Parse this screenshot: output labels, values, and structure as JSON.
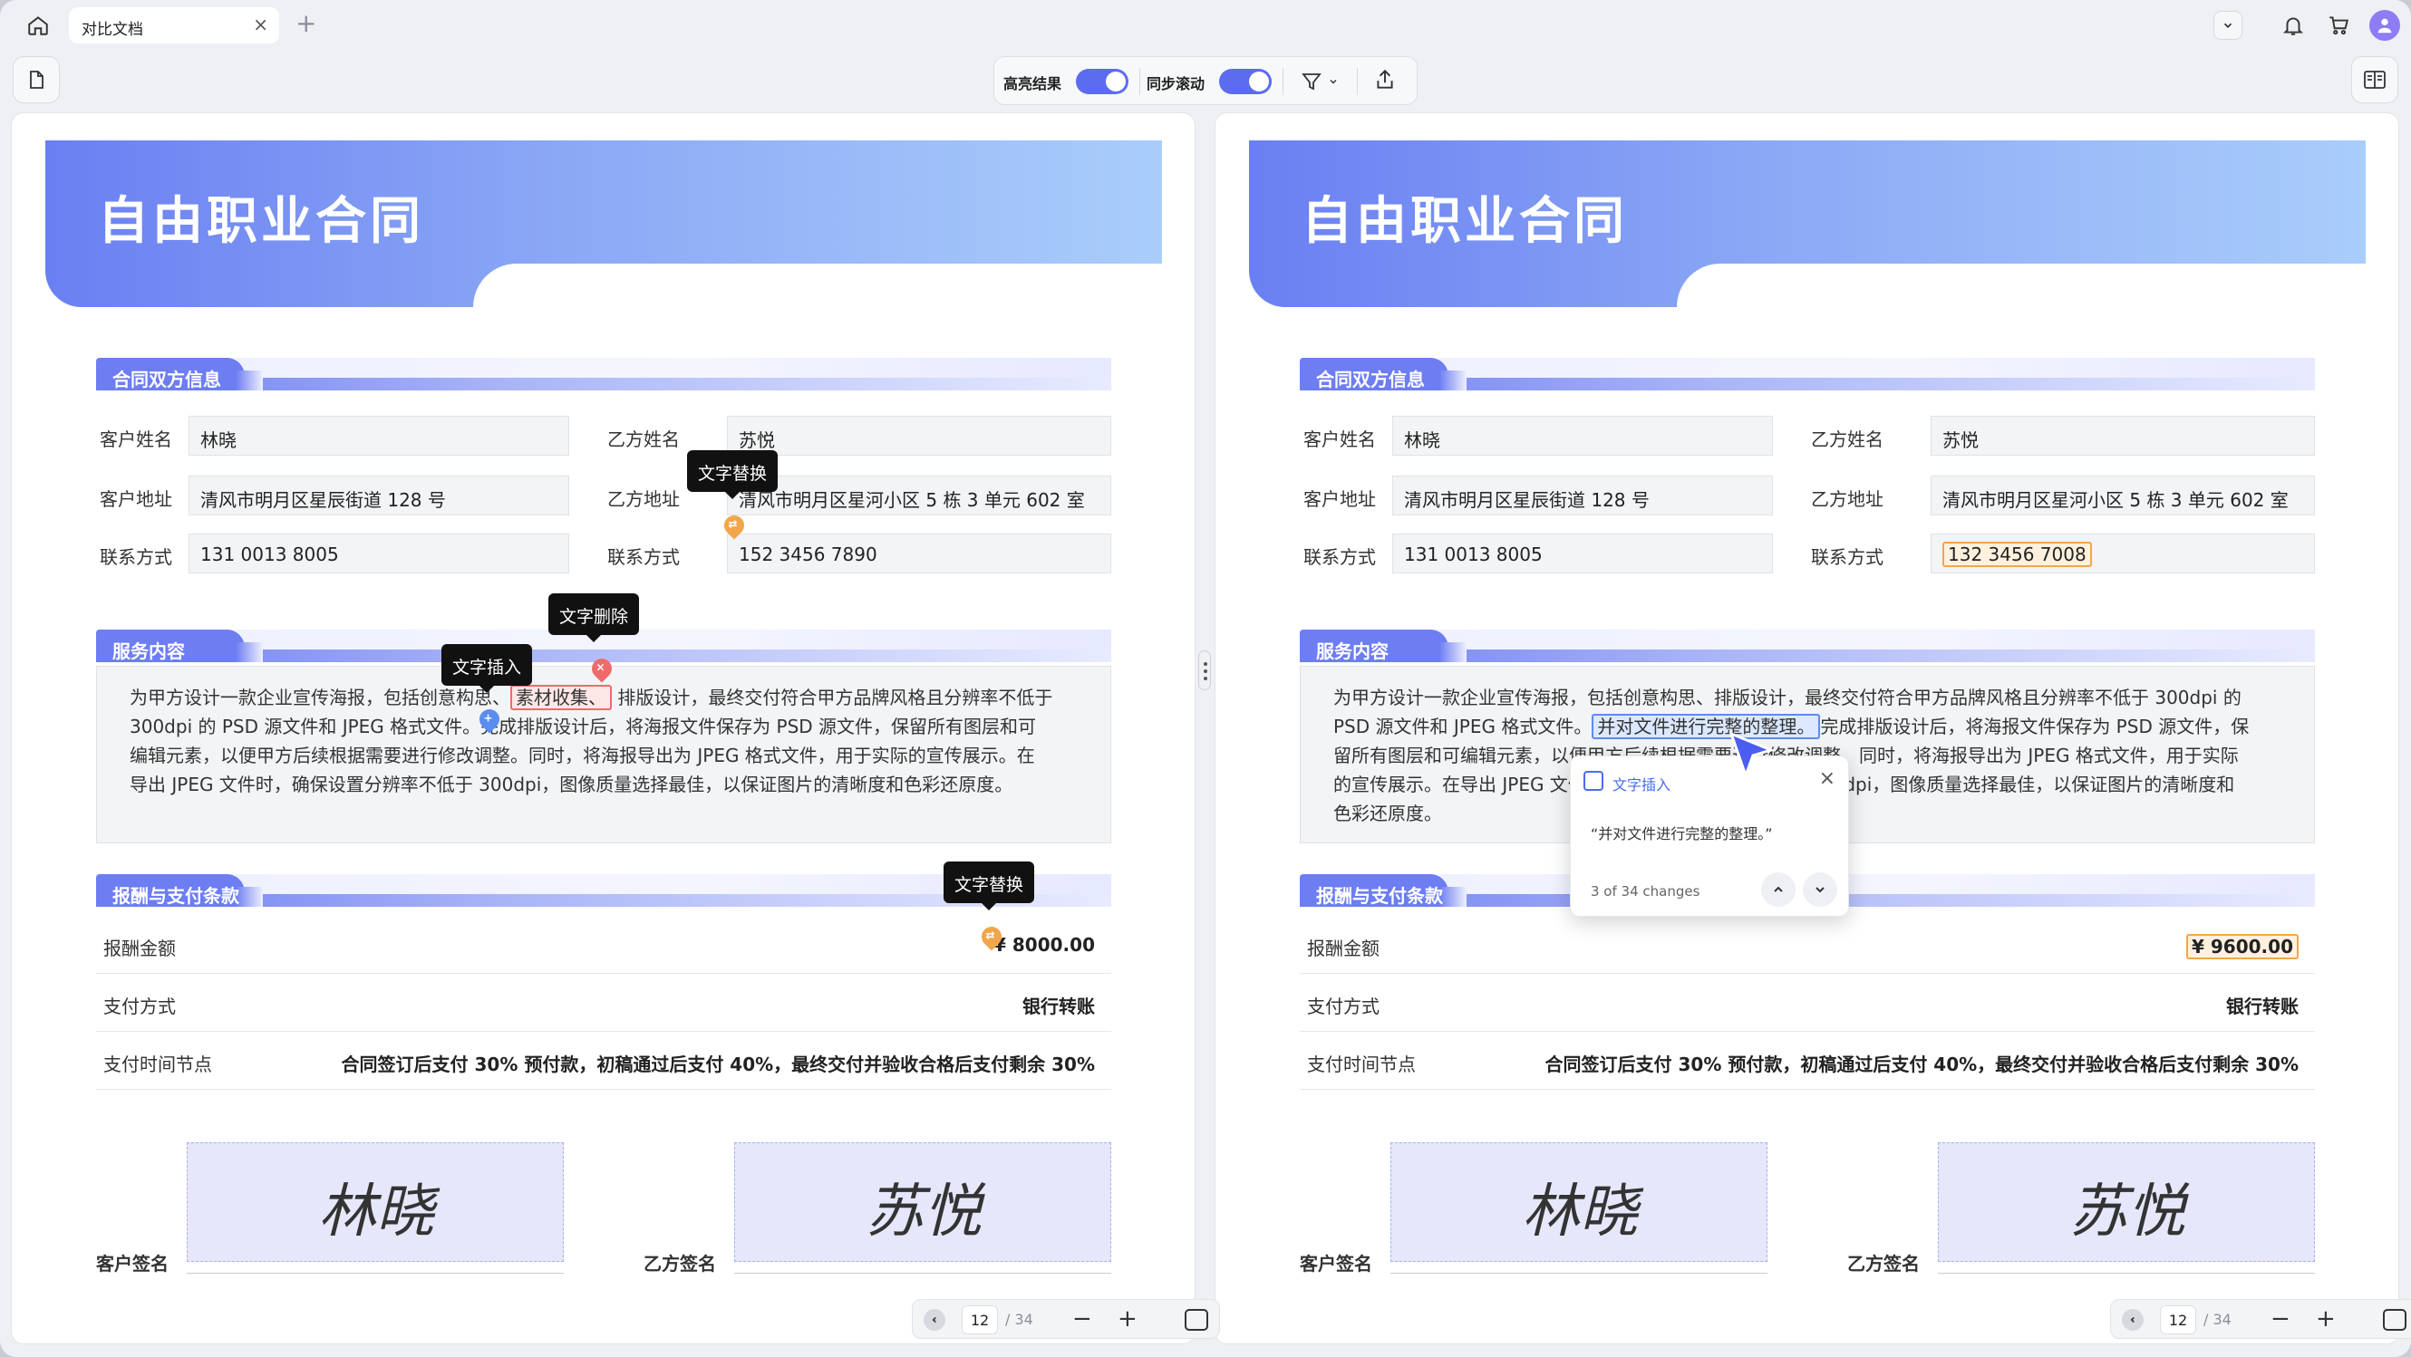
{
  "tab": {
    "title": "对比文档",
    "close": "×",
    "add": "+"
  },
  "toolbar": {
    "highlight_label": "高亮结果",
    "sync_label": "同步滚动"
  },
  "doc": {
    "title": "自由职业合同",
    "section1": "合同双方信息",
    "section2": "服务内容",
    "section3": "报酬与支付条款",
    "client_name_label": "客户姓名",
    "client_name": "林晓",
    "client_addr_label": "客户地址",
    "client_addr": "清风市明月区星辰街道 128 号",
    "client_phone_label": "联系方式",
    "client_phone": "131 0013 8005",
    "partyb_name_label": "乙方姓名",
    "partyb_name": "苏悦",
    "partyb_addr_label": "乙方地址",
    "partyb_addr": "清风市明月区星河小区 5 栋 3 单元 602 室",
    "partyb_phone_label": "联系方式",
    "pay_amount_label": "报酬金额",
    "pay_method_label": "支付方式",
    "pay_method": "银行转账",
    "pay_schedule_label": "支付时间节点",
    "pay_schedule": "合同签订后支付 30% 预付款，初稿通过后支付 40%，最终交付并验收合格后支付剩余 30%",
    "client_sig_label": "客户签名",
    "partyb_sig_label": "乙方签名",
    "client_sig": "林晓",
    "partyb_sig": "苏悦"
  },
  "left": {
    "partyb_phone": "152 3456 7890",
    "pay_amount": "¥ 8000.00",
    "svc_p1": "为甲方设计一款企业宣传海报，包括创意构思、",
    "svc_del": "素材收集、",
    "svc_p2": "排版设计，最终交付符合甲方品牌风格且分辨率不低于",
    "svc_l2a": "300dpi 的 PSD 源文件和 JPEG 格式文件。",
    "svc_l2b": "完成排版设计后，将海报文件保存为 PSD 源文件，保留所有图层和可",
    "svc_l3": "编辑元素，以便甲方后续根据需要进行修改调整。同时，将海报导出为 JPEG 格式文件，用于实际的宣传展示。在",
    "svc_l4": "导出 JPEG 文件时，确保设置分辨率不低于 300dpi，图像质量选择最佳，以保证图片的清晰度和色彩还原度。",
    "tip_replace1": "文字替换",
    "tip_delete": "文字删除",
    "tip_insert": "文字插入",
    "tip_replace2": "文字替换"
  },
  "right": {
    "partyb_phone": "132 3456 7008",
    "pay_amount": "¥ 9600.00",
    "svc_l1": "为甲方设计一款企业宣传海报，包括创意构思、排版设计，最终交付符合甲方品牌风格且分辨率不低于 300dpi 的",
    "svc_l2a": "PSD 源文件和 JPEG 格式文件。",
    "svc_ins": "并对文件进行完整的整理。",
    "svc_l2b": "完成排版设计后，将海报文件保存为 PSD 源文件，保",
    "svc_l3": "留所有图层和可编辑元素，以便甲方后续根据需要进行修改调整。同时，将海报导出为 JPEG 格式文件，用于实际",
    "svc_l4": "的宣传展示。在导出 JPEG 文件时，确保设置分辨率不低于 300dpi，图像质量选择最佳，以保证图片的清晰度和",
    "svc_l5": "色彩还原度。"
  },
  "popover": {
    "title": "文字插入",
    "quote": "“并对文件进行完整的整理。”",
    "count": "3 of 34 changes"
  },
  "footer": {
    "page": "12",
    "total": "/ 34"
  },
  "colors": {
    "accent": "#5b6cf0",
    "delete": "#ef6b6b",
    "insert": "#5b8cf0",
    "replace": "#f2a64a"
  }
}
